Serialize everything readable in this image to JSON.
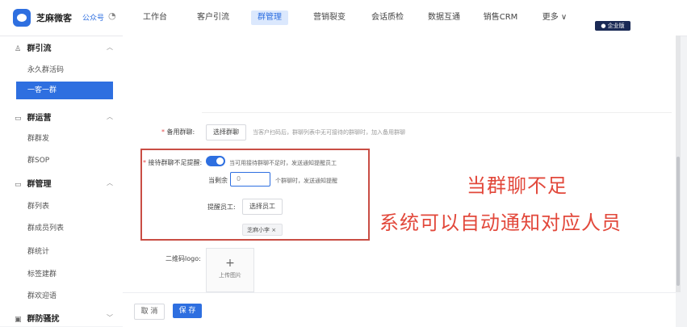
{
  "app": {
    "brand": "芝麻微客",
    "account": "公众号",
    "vip_badge": "企业版"
  },
  "nav": {
    "items": [
      "工作台",
      "客户引流",
      "群管理",
      "营销裂变",
      "会话质检",
      "数据互通",
      "销售CRM",
      "更多 ∨"
    ],
    "active": "群管理"
  },
  "sidebar": {
    "groups": [
      {
        "title": "群引流",
        "items": [
          "永久群活码",
          "一客一群"
        ]
      },
      {
        "title": "群运营",
        "items": [
          "群群发",
          "群SOP"
        ]
      },
      {
        "title": "群管理",
        "items": [
          "群列表",
          "群成员列表",
          "群统计",
          "标签建群",
          "群欢迎语"
        ]
      },
      {
        "title": "群防骚扰",
        "items": []
      }
    ],
    "active_item": "一客一群"
  },
  "form": {
    "backup_group": {
      "label": "备用群聊:",
      "button": "选择群聊",
      "hint": "当客户扫码后，群聊列表中无可接待的群聊时，加入备用群聊"
    },
    "insufficient": {
      "label": "接待群聊不足提醒:",
      "toggle_on": true,
      "toggle_text": "当可用接待群聊不足时，发送通知提醒员工",
      "remain_prefix": "当剩余",
      "remain_value": "0",
      "remain_suffix": "个群聊时，发送通知提醒",
      "notify_label": "提醒员工:",
      "notify_button": "选择员工",
      "staff_tag": "芝麻小李 ×"
    },
    "logo": {
      "label": "二维码logo:",
      "upload_plus": "+",
      "upload_text": "上传图片"
    }
  },
  "annotation": {
    "line1": "当群聊不足",
    "line2": "系统可以自动通知对应人员"
  },
  "footer": {
    "cancel": "取 消",
    "save": "保 存"
  },
  "colors": {
    "accent": "#2e6fe0",
    "annotation_red": "#e2483b",
    "box_red": "#c94d44"
  }
}
